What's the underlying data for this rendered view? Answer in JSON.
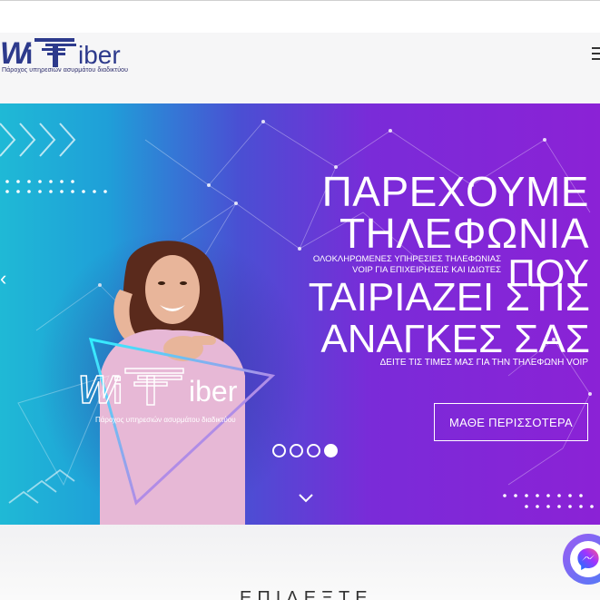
{
  "header": {
    "logo_text": "WiFiber",
    "logo_tagline": "Πάροχος υπηρεσιών ασυρμάτου διαδικτύου",
    "menu_icon": "hamburger-icon"
  },
  "hero": {
    "headline_line1": "ΠΑΡΕΧΟΥΜΕ",
    "headline_line2": "ΤΗΛΕΦΩΝΙΑ",
    "headline_line3": "ΠΟΥ",
    "headline_line4": "ΤΑΙΡΙΑΖΕΙ ΣΤΙΣ",
    "headline_line5": "ΑΝΑΓΚΕΣ ΣΑΣ",
    "subtitle_line1": "ΟΛΟΚΛΗΡΩΜΕΝΕΣ ΥΠΗΡΕΣΙΕΣ ΤΗΛΕΦΩΝΙΑΣ",
    "subtitle_line2": "VOIP ΓΙΑ ΕΠΙΧΕΙΡΗΣΕΙΣ ΚΑΙ ΙΔΙΩΤΕΣ",
    "subtitle2": "ΔΕΙΤΕ ΤΙΣ ΤΙΜΕΣ ΜΑΣ ΓΙΑ ΤΗΝ ΤΗΛΕΦΩΝΗ VOIP",
    "cta_label": "ΜΑΘΕ ΠΕΡΙΣΣΟΤΕΡΑ",
    "image_logo_text": "WiFiber",
    "image_logo_tagline": "Πάροχος υπηρεσιών ασυρμάτου διαδικτύου",
    "slides_total": 4,
    "active_slide": 4,
    "colors": {
      "gradient_start": "#1fb9d6",
      "gradient_end": "#8b22d6"
    }
  },
  "section": {
    "title_partial": "ΕΠΙΛΕΞΤΕ"
  },
  "widgets": {
    "chat_icon": "messenger-icon"
  }
}
